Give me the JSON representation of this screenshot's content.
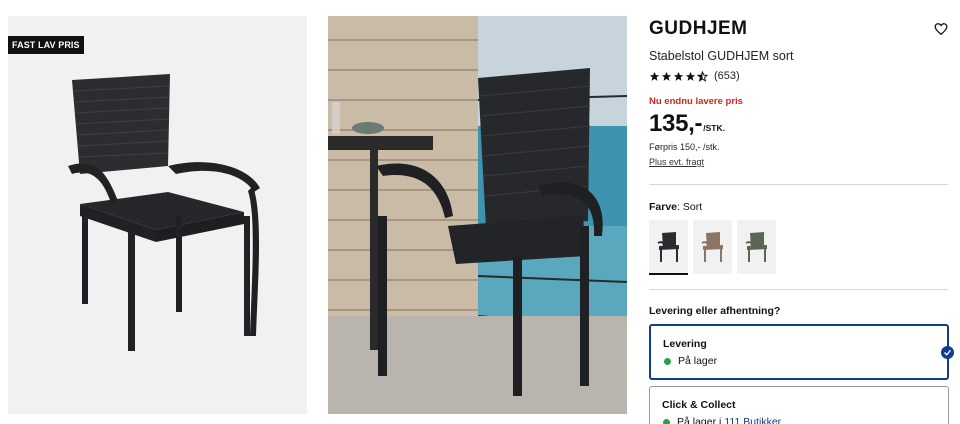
{
  "badge": "FAST LAV PRIS",
  "product": {
    "brand": "GUDHJEM",
    "subtitle": "Stabelstol GUDHJEM sort",
    "rating_count": "(653)",
    "promo": "Nu endnu lavere pris",
    "price": "135,-",
    "unit": "/STK.",
    "before_price": "Førpris 150,- /stk.",
    "freight_link": "Plus evt. fragt"
  },
  "color": {
    "label": "Farve",
    "value": ": Sort",
    "swatches": [
      {
        "name": "sort",
        "hex": "#2a2c2f"
      },
      {
        "name": "brun",
        "hex": "#8d7565"
      },
      {
        "name": "grøn",
        "hex": "#5b6656"
      }
    ]
  },
  "delivery": {
    "title": "Levering eller afhentning?",
    "options": [
      {
        "title": "Levering",
        "status": "På lager",
        "selected": true
      },
      {
        "title": "Click & Collect",
        "status": "På lager i",
        "link": "111 Butikker"
      }
    ]
  },
  "colors": {
    "accent": "#0f3e8c",
    "promo_red": "#d0261b",
    "in_stock_green": "#2e9e4d"
  },
  "icons": {
    "favorite": "heart-outline-icon",
    "check": "check-circle-icon",
    "stars": "star-icon"
  }
}
